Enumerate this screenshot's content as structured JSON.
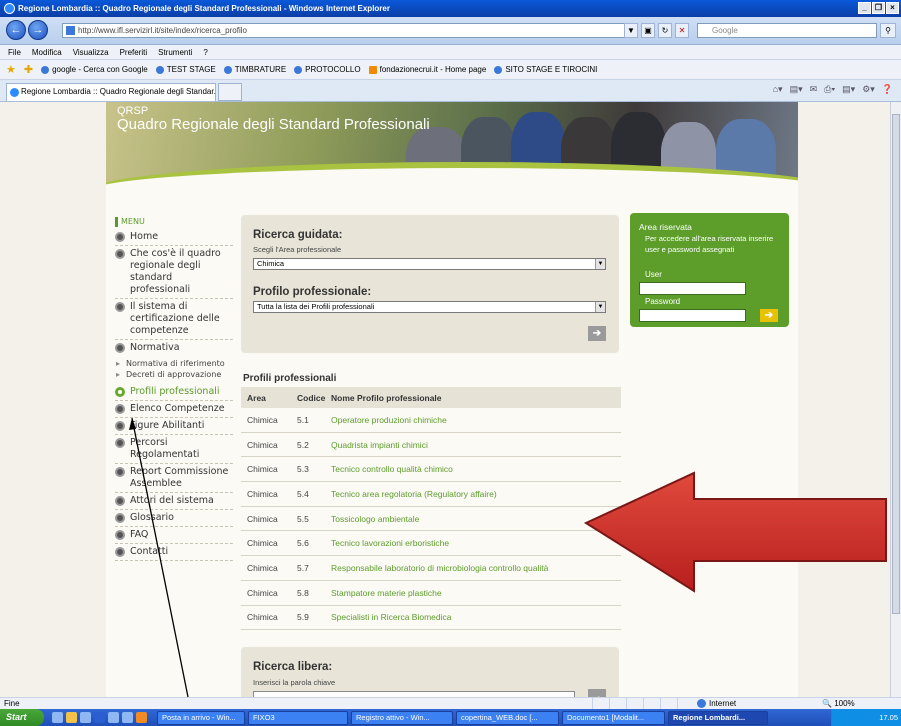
{
  "window": {
    "title": "Regione Lombardia :: Quadro Regionale degli Standard Professionali - Windows Internet Explorer",
    "buttons": [
      "_",
      "❐",
      "×"
    ]
  },
  "address": {
    "url": "http://www.ifl.servizirl.it/site/index/ricerca_profilo",
    "search_placeholder": "Google"
  },
  "menubar": [
    "File",
    "Modifica",
    "Visualizza",
    "Preferiti",
    "Strumenti",
    "?"
  ],
  "favorites": [
    "google - Cerca con Google",
    "TEST STAGE",
    "TIMBRATURE",
    "PROTOCOLLO",
    "fondazionecrui.it - Home page",
    "SITO STAGE E TIROCINI"
  ],
  "tab": {
    "label": "Regione Lombardia :: Quadro Regionale degli Standar..."
  },
  "banner": {
    "acronym": "QRSP",
    "title": "Quadro Regionale degli Standard Professionali"
  },
  "menu": {
    "heading": "MENU",
    "items": [
      "Home",
      "Che cos'è il quadro regionale degli standard professionali",
      "Il sistema di certificazione delle competenze",
      "Normativa"
    ],
    "subitems": [
      "Normativa di riferimento",
      "Decreti di approvazione"
    ],
    "items2": [
      "Profili professionali",
      "Elenco Competenze",
      "Figure Abilitanti",
      "Percorsi Regolamentati",
      "Report Commissione Assemblee",
      "Attori del sistema",
      "Glossario",
      "FAQ",
      "Contatti"
    ]
  },
  "guided_search": {
    "title": "Ricerca guidata:",
    "hint": "Scegli l'Area professionale",
    "area_value": "Chimica",
    "profile_title": "Profilo professionale:",
    "profile_value": "Tutta la lista dei Profili professionali",
    "go": "➔"
  },
  "login": {
    "title": "Area riservata",
    "desc": "Per accedere all'area riservata inserire user e password assegnati",
    "user_label": "User",
    "password_label": "Password",
    "go": "➔"
  },
  "results": {
    "title": "Profili professionali",
    "headers": [
      "Area",
      "Codice",
      "Nome Profilo professionale"
    ],
    "rows": [
      [
        "Chimica",
        "5.1",
        "Operatore produzioni chimiche"
      ],
      [
        "Chimica",
        "5.2",
        "Quadrista impianti chimici"
      ],
      [
        "Chimica",
        "5.3",
        "Tecnico controllo qualità chimico"
      ],
      [
        "Chimica",
        "5.4",
        "Tecnico area regolatoria (Regulatory affaire)"
      ],
      [
        "Chimica",
        "5.5",
        "Tossicologo ambientale"
      ],
      [
        "Chimica",
        "5.6",
        "Tecnico lavorazioni erboristiche"
      ],
      [
        "Chimica",
        "5.7",
        "Responsabile laboratorio di microbiologia controllo qualità"
      ],
      [
        "Chimica",
        "5.8",
        "Stampatore materie plastiche"
      ],
      [
        "Chimica",
        "5.9",
        "Specialisti in Ricerca Biomedica"
      ]
    ]
  },
  "free_search": {
    "title": "Ricerca libera:",
    "hint": "Inserisci la parola chiave"
  },
  "status": {
    "text": "Fine",
    "zone": "Internet",
    "zoom": "100%"
  },
  "taskbar": {
    "start": "Start",
    "tasks": [
      "Posta in arrivo - Win...",
      "FIXO3",
      "Registro attivo - Win...",
      "copertina_WEB.doc [...",
      "Documento1 [Modalit...",
      "Regione Lombardi..."
    ],
    "clock": "17.05"
  },
  "colors": {
    "accent_green": "#5d9e2b",
    "link_green": "#5d9c2c",
    "arrow_red": "#c62a2a"
  }
}
